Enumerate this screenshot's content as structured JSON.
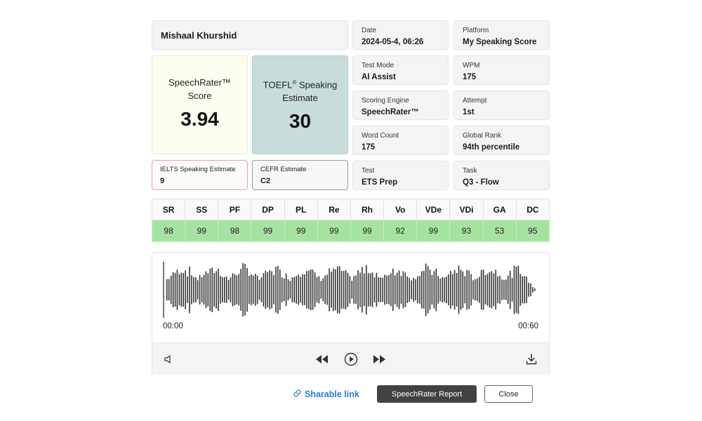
{
  "candidate": {
    "name": "Mishaal Khurshid"
  },
  "scores": {
    "speechrater": {
      "title": "SpeechRater™ Score",
      "value": "3.94"
    },
    "toefl": {
      "title_prefix": "TOEFL",
      "title_mark": "®",
      "title_suffix": " Speaking Estimate",
      "value": "30"
    }
  },
  "estimates": [
    {
      "label": "IELTS Speaking Estimate",
      "value": "9"
    },
    {
      "label": "CEFR Estimate",
      "value": "C2"
    }
  ],
  "info": [
    {
      "label": "Date",
      "value": "2024-05-4, 06:26"
    },
    {
      "label": "Platform",
      "value": "My Speaking Score"
    },
    {
      "label": "Test Mode",
      "value": "AI Assist"
    },
    {
      "label": "WPM",
      "value": "175"
    },
    {
      "label": "Scoring Engine",
      "value": "SpeechRater™"
    },
    {
      "label": "Attempt",
      "value": "1st"
    },
    {
      "label": "Word Count",
      "value": "175"
    },
    {
      "label": "Global Rank",
      "value": "94th percentile"
    },
    {
      "label": "Test",
      "value": "ETS Prep"
    },
    {
      "label": "Task",
      "value": "Q3 - Flow"
    }
  ],
  "metrics": {
    "headers": [
      "SR",
      "SS",
      "PF",
      "DP",
      "PL",
      "Re",
      "Rh",
      "Vo",
      "VDe",
      "VDi",
      "GA",
      "DC"
    ],
    "values": [
      "98",
      "99",
      "98",
      "99",
      "99",
      "99",
      "99",
      "92",
      "99",
      "93",
      "53",
      "95"
    ]
  },
  "player": {
    "start_time": "00:00",
    "end_time": "00:60",
    "icons": [
      "volume-icon",
      "rewind-icon",
      "play-icon",
      "fast-forward-icon",
      "download-icon"
    ]
  },
  "actions": {
    "share_link": "Sharable link",
    "report_button": "SpeechRater Report",
    "close_button": "Close"
  },
  "colors": {
    "metric_row_bg": "#a7e3a0",
    "speechrater_card_bg": "#fdfdf0",
    "toefl_card_bg": "#c8dcdc",
    "link": "#2f7bd6",
    "report_button_bg": "#424242"
  }
}
